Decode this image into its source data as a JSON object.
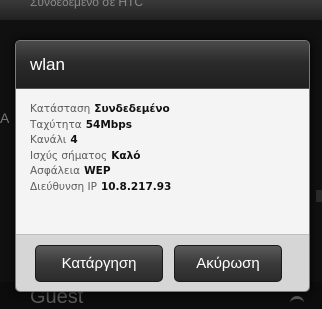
{
  "background": {
    "top_text": "Συνδεδεμένο σε HTC",
    "left_char": "A",
    "bottom_text": "Guest"
  },
  "dialog": {
    "title": "wlan",
    "details": [
      {
        "label": "Κατάσταση",
        "value": "Συνδεδεμένο"
      },
      {
        "label": "Ταχύτητα",
        "value": "54Mbps"
      },
      {
        "label": "Κανάλι",
        "value": "4"
      },
      {
        "label": "Ισχύς σήματος",
        "value": "Καλό"
      },
      {
        "label": "Ασφάλεια",
        "value": "WEP"
      },
      {
        "label": "Διεύθυνση IP",
        "value": "10.8.217.93"
      }
    ],
    "buttons": {
      "remove": "Κατάργηση",
      "cancel": "Ακύρωση"
    }
  }
}
